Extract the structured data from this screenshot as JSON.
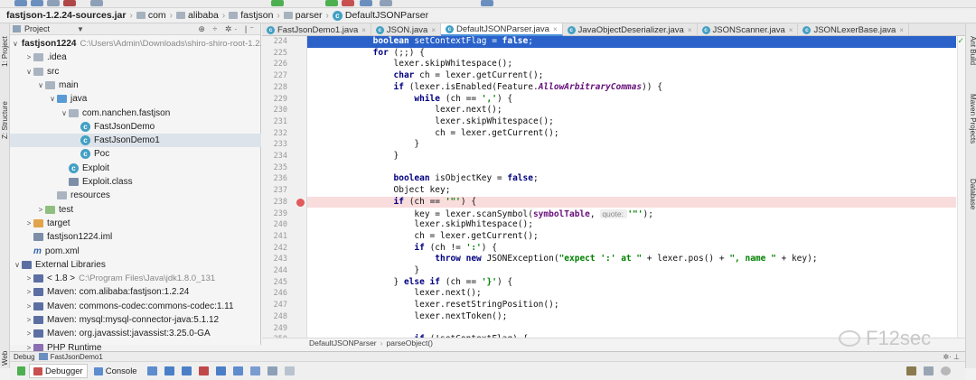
{
  "breadcrumb": [
    {
      "label": "fastjson-1.2.24-sources.jar",
      "kind": "jar"
    },
    {
      "label": "com",
      "kind": "folder"
    },
    {
      "label": "alibaba",
      "kind": "folder"
    },
    {
      "label": "fastjson",
      "kind": "folder"
    },
    {
      "label": "parser",
      "kind": "folder"
    },
    {
      "label": "DefaultJSONParser",
      "kind": "class"
    }
  ],
  "left_strip": {
    "project_tab": "1: Project",
    "structure_tab": "Z: Structure",
    "web_tab": "Web"
  },
  "right_strip": {
    "ant_build": "Ant Build",
    "maven_projects": "Maven Projects",
    "database": "Database"
  },
  "project_panel": {
    "title": "Project",
    "tree": [
      {
        "depth": 0,
        "arrow": "v",
        "icon": "folder",
        "label": "fastjson1224",
        "bold": true,
        "extra": "C:\\Users\\Admin\\Downloads\\shiro-shiro-root-1.2.4"
      },
      {
        "depth": 1,
        "arrow": ">",
        "icon": "folder",
        "label": ".idea"
      },
      {
        "depth": 1,
        "arrow": "v",
        "icon": "folder",
        "label": "src"
      },
      {
        "depth": 2,
        "arrow": "v",
        "icon": "folder",
        "label": "main"
      },
      {
        "depth": 3,
        "arrow": "v",
        "icon": "src",
        "label": "java"
      },
      {
        "depth": 4,
        "arrow": "v",
        "icon": "pkg",
        "label": "com.nanchen.fastjson"
      },
      {
        "depth": 5,
        "arrow": "",
        "icon": "class",
        "label": "FastJsonDemo"
      },
      {
        "depth": 5,
        "arrow": "",
        "icon": "class",
        "label": "FastJsonDemo1",
        "selected": true
      },
      {
        "depth": 5,
        "arrow": "",
        "icon": "class",
        "label": "Poc"
      },
      {
        "depth": 4,
        "arrow": "",
        "icon": "class",
        "label": "Exploit"
      },
      {
        "depth": 4,
        "arrow": "",
        "icon": "classfile",
        "label": "Exploit.class"
      },
      {
        "depth": 3,
        "arrow": "",
        "icon": "folder",
        "label": "resources"
      },
      {
        "depth": 2,
        "arrow": ">",
        "icon": "test",
        "label": "test"
      },
      {
        "depth": 1,
        "arrow": ">",
        "icon": "target",
        "label": "target"
      },
      {
        "depth": 1,
        "arrow": "",
        "icon": "iml",
        "label": "fastjson1224.iml"
      },
      {
        "depth": 1,
        "arrow": "",
        "icon": "maven",
        "label": "pom.xml"
      },
      {
        "depth": 0,
        "arrow": "v",
        "icon": "lib",
        "label": "External Libraries"
      },
      {
        "depth": 1,
        "arrow": ">",
        "icon": "lib",
        "label": "< 1.8 >",
        "extra": "C:\\Program Files\\Java\\jdk1.8.0_131"
      },
      {
        "depth": 1,
        "arrow": ">",
        "icon": "lib",
        "label": "Maven: com.alibaba:fastjson:1.2.24"
      },
      {
        "depth": 1,
        "arrow": ">",
        "icon": "lib",
        "label": "Maven: commons-codec:commons-codec:1.11"
      },
      {
        "depth": 1,
        "arrow": ">",
        "icon": "lib",
        "label": "Maven: mysql:mysql-connector-java:5.1.12"
      },
      {
        "depth": 1,
        "arrow": ">",
        "icon": "lib",
        "label": "Maven: org.javassist:javassist:3.25.0-GA"
      },
      {
        "depth": 1,
        "arrow": ">",
        "icon": "php",
        "label": "PHP Runtime"
      }
    ]
  },
  "editor_tabs": [
    {
      "label": "FastJsonDemo1.java"
    },
    {
      "label": "JSON.java"
    },
    {
      "label": "DefaultJSONParser.java",
      "active": true
    },
    {
      "label": "JavaObjectDeserializer.java"
    },
    {
      "label": "JSONScanner.java"
    },
    {
      "label": "JSONLexerBase.java"
    }
  ],
  "editor": {
    "first_line": 224,
    "exec_line": 224,
    "breakpoint_line": 238,
    "lines": [
      [
        [
          "            ",
          ""
        ],
        [
          "boolean",
          "kw"
        ],
        [
          " setContextFlag = ",
          ""
        ],
        [
          "false",
          "kw"
        ],
        [
          ";",
          ""
        ]
      ],
      [
        [
          "            ",
          ""
        ],
        [
          "for",
          "kw"
        ],
        [
          " (;;) {",
          ""
        ]
      ],
      [
        [
          "                lexer.skipWhitespace();",
          ""
        ]
      ],
      [
        [
          "                ",
          ""
        ],
        [
          "char",
          "kw"
        ],
        [
          " ch = lexer.getCurrent();",
          ""
        ]
      ],
      [
        [
          "                ",
          ""
        ],
        [
          "if",
          "kw"
        ],
        [
          " (lexer.isEnabled(Feature.",
          ""
        ],
        [
          "AllowArbitraryCommas",
          "it"
        ],
        [
          ")) {",
          ""
        ]
      ],
      [
        [
          "                    ",
          ""
        ],
        [
          "while",
          "kw"
        ],
        [
          " (ch == ",
          ""
        ],
        [
          "','",
          "str"
        ],
        [
          ") {",
          ""
        ]
      ],
      [
        [
          "                        lexer.next();",
          ""
        ]
      ],
      [
        [
          "                        lexer.skipWhitespace();",
          ""
        ]
      ],
      [
        [
          "                        ch = lexer.getCurrent();",
          ""
        ]
      ],
      [
        [
          "                    }",
          ""
        ]
      ],
      [
        [
          "                }",
          ""
        ]
      ],
      [
        [
          "",
          ""
        ]
      ],
      [
        [
          "                ",
          ""
        ],
        [
          "boolean",
          "kw"
        ],
        [
          " isObjectKey = ",
          ""
        ],
        [
          "false",
          "kw"
        ],
        [
          ";",
          ""
        ]
      ],
      [
        [
          "                Object key;",
          ""
        ]
      ],
      [
        [
          "                ",
          ""
        ],
        [
          "if",
          "kw"
        ],
        [
          " (ch == ",
          ""
        ],
        [
          "'\"'",
          "str"
        ],
        [
          ") {",
          ""
        ]
      ],
      [
        [
          "                    key = lexer.scanSymbol(",
          ""
        ],
        [
          "symbolTable",
          "fld"
        ],
        [
          ", ",
          ""
        ],
        [
          "quote: ",
          "hint"
        ],
        [
          "'\"'",
          "str"
        ],
        [
          ");",
          ""
        ]
      ],
      [
        [
          "                    lexer.skipWhitespace();",
          ""
        ]
      ],
      [
        [
          "                    ch = lexer.getCurrent();",
          ""
        ]
      ],
      [
        [
          "                    ",
          ""
        ],
        [
          "if",
          "kw"
        ],
        [
          " (ch != ",
          ""
        ],
        [
          "':'",
          "str"
        ],
        [
          ") {",
          ""
        ]
      ],
      [
        [
          "                        ",
          ""
        ],
        [
          "throw new",
          "kw"
        ],
        [
          " JSONException(",
          ""
        ],
        [
          "\"expect ':' at \"",
          "str"
        ],
        [
          " + lexer.pos() + ",
          ""
        ],
        [
          "\", name \"",
          "str"
        ],
        [
          " + key);",
          ""
        ]
      ],
      [
        [
          "                    }",
          ""
        ]
      ],
      [
        [
          "                } ",
          ""
        ],
        [
          "else if",
          "kw"
        ],
        [
          " (ch == ",
          ""
        ],
        [
          "'}'",
          "str"
        ],
        [
          ") {",
          ""
        ]
      ],
      [
        [
          "                    lexer.next();",
          ""
        ]
      ],
      [
        [
          "                    lexer.resetStringPosition();",
          ""
        ]
      ],
      [
        [
          "                    lexer.nextToken();",
          ""
        ]
      ],
      [
        [
          "",
          ""
        ]
      ],
      [
        [
          "                    ",
          ""
        ],
        [
          "if",
          "kw"
        ],
        [
          " (!setContextFlag) {",
          ""
        ]
      ]
    ]
  },
  "editor_breadcrumb": {
    "class_name": "DefaultJSONParser",
    "method": "parseObject()"
  },
  "debug": {
    "title": "Debug",
    "config": "FastJsonDemo1",
    "tabs": [
      {
        "label": "Debugger",
        "active": true
      },
      {
        "label": "Console"
      }
    ]
  },
  "watermark": "F12sec",
  "colors": {
    "exec_highlight": "#2a62c9",
    "breakpoint_bg": "#f9dcdc",
    "breakpoint_dot": "#e25a5a",
    "class_icon": "#43a0c4"
  }
}
